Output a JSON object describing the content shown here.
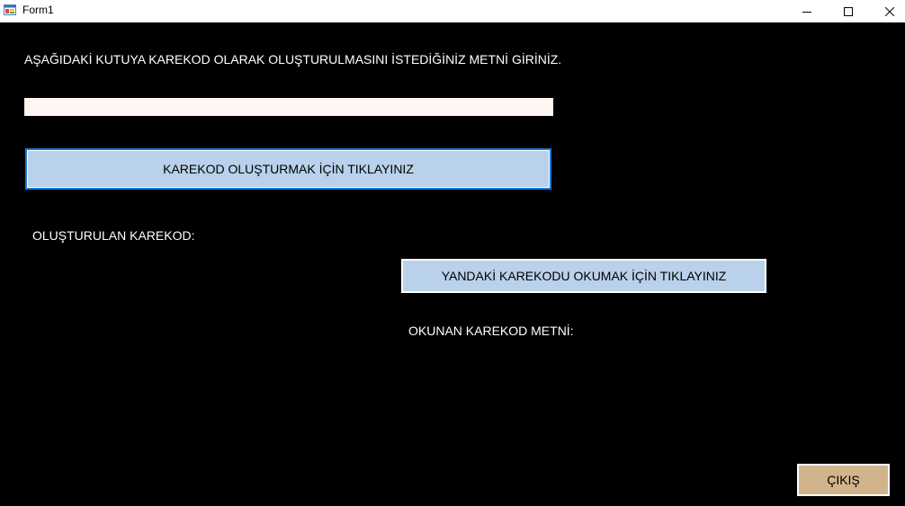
{
  "window": {
    "title": "Form1",
    "app_icon": "form-app-icon",
    "controls": {
      "minimize_icon": "minimize-icon",
      "maximize_icon": "maximize-icon",
      "close_icon": "close-icon"
    }
  },
  "form": {
    "instruction_label": "AŞAĞIDAKİ KUTUYA KAREKOD OLARAK OLUŞTURULMASINI İSTEDİĞİNİZ METNİ GİRİNİZ.",
    "input_value": "",
    "create_button_label": "KAREKOD OLUŞTURMAK İÇİN TIKLAYINIZ",
    "generated_label": "OLUŞTURULAN KAREKOD:",
    "read_button_label": "YANDAKİ KAREKODU OKUMAK İÇİN TIKLAYINIZ",
    "read_text_label": "OKUNAN KAREKOD METNİ:",
    "exit_button_label": "ÇIKIŞ"
  },
  "colors": {
    "background": "#000000",
    "input_background": "#fff5f3",
    "button_blue": "#b9d1ea",
    "button_tan": "#d2b48c",
    "focus_border": "#1e78d2"
  }
}
